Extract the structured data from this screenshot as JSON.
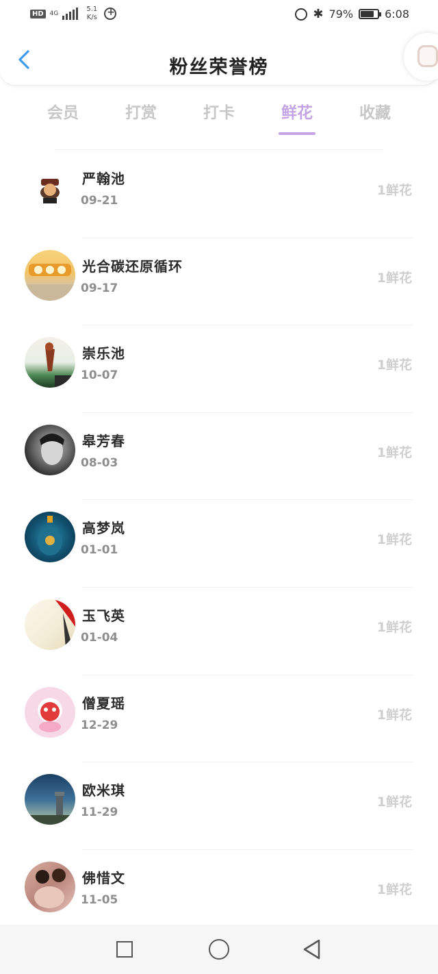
{
  "status_bar": {
    "hd": "HD",
    "network": "4G",
    "speed_value": "5.1",
    "speed_unit": "K/s",
    "battery": "79%",
    "battery_level": 0.79,
    "time": "6:08"
  },
  "header": {
    "title": "粉丝荣誉榜"
  },
  "tabs": [
    {
      "label": "会员"
    },
    {
      "label": "打赏"
    },
    {
      "label": "打卡"
    },
    {
      "label": "鲜花",
      "active": true
    },
    {
      "label": "收藏"
    }
  ],
  "fans": [
    {
      "name": "严翰池",
      "date": "09-21",
      "gift": "1鲜花",
      "avatar": "cartoon-character-avatar"
    },
    {
      "name": "光合碳还原循环",
      "date": "09-17",
      "gift": "1鲜花",
      "avatar": "game-logo-avatar"
    },
    {
      "name": "崇乐池",
      "date": "10-07",
      "gift": "1鲜花",
      "avatar": "landscape-figure-avatar"
    },
    {
      "name": "皋芳春",
      "date": "08-03",
      "gift": "1鲜花",
      "avatar": "portrait-avatar"
    },
    {
      "name": "高梦岚",
      "date": "01-01",
      "gift": "1鲜花",
      "avatar": "blue-bottle-avatar"
    },
    {
      "name": "玉飞英",
      "date": "01-04",
      "gift": "1鲜花",
      "avatar": "artwork-avatar"
    },
    {
      "name": "僧夏瑶",
      "date": "12-29",
      "gift": "1鲜花",
      "avatar": "cute-cartoon-avatar"
    },
    {
      "name": "欧米琪",
      "date": "11-29",
      "gift": "1鲜花",
      "avatar": "night-sky-avatar"
    },
    {
      "name": "佛惜文",
      "date": "11-05",
      "gift": "1鲜花",
      "avatar": "couple-photo-avatar"
    }
  ],
  "colors": {
    "accent": "#c4a4e4",
    "back_arrow": "#3d9bf0",
    "inactive_tab": "#c7c7c7"
  }
}
